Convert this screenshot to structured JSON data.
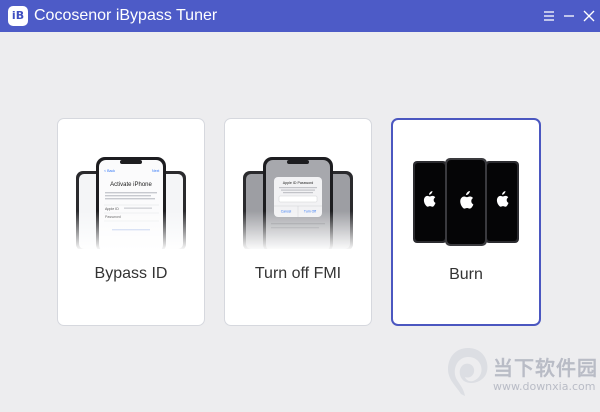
{
  "app": {
    "title": "Cocosenor iBypass Tuner",
    "logo_text": "iB",
    "accent_color": "#4d5bc7"
  },
  "window_controls": {
    "menu_icon": "hamburger-menu-icon",
    "minimize_icon": "minimize-icon",
    "close_icon": "close-icon"
  },
  "cards": [
    {
      "label": "Bypass ID",
      "icon": "iphone-activation-screen-illustration",
      "phone_screen": {
        "header_left": "< Back",
        "header_right": "Next",
        "title": "Activate iPhone",
        "field_1": "Apple ID",
        "field_2": "Password"
      },
      "selected": false
    },
    {
      "label": "Turn off FMI",
      "icon": "iphone-apple-id-password-dialog-illustration",
      "phone_screen": {
        "dialog_title": "Apple ID Password",
        "dialog_btn_left": "Cancel",
        "dialog_btn_right": "Turn Off"
      },
      "selected": false
    },
    {
      "label": "Burn",
      "icon": "iphone-apple-logo-illustration",
      "selected": true
    }
  ],
  "watermark": {
    "name": "当下软件园",
    "url": "www.downxia.com"
  }
}
